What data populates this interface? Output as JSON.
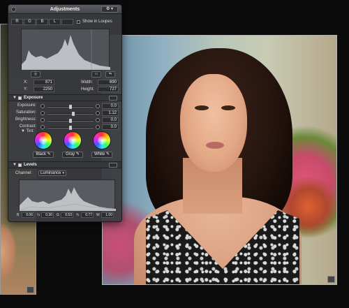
{
  "hud": {
    "title": "Adjustments",
    "gear_label": "⚙ ▾",
    "channels": [
      "R",
      "G",
      "B",
      "L",
      ""
    ],
    "show_in_loupes": "Show in Loupes",
    "tool_buttons": [
      "◎",
      "▭",
      "⇆"
    ],
    "coords": {
      "x_label": "X:",
      "x_value": "871",
      "y_label": "Y:",
      "y_value": "2250",
      "width_label": "Width:",
      "width_value": "690",
      "height_label": "Height:",
      "height_value": "727"
    },
    "exposure": {
      "title": "Exposure",
      "rows": [
        {
          "label": "Exposure:",
          "value": "0.0",
          "pos": 0.5
        },
        {
          "label": "Saturation:",
          "value": "1.12",
          "pos": 0.56
        },
        {
          "label": "Brightness:",
          "value": "0.0",
          "pos": 0.5
        },
        {
          "label": "Contrast:",
          "value": "0.0",
          "pos": 0.5
        }
      ]
    },
    "tint": {
      "label": "Tint:",
      "buttons": [
        "Black",
        "Gray",
        "White"
      ]
    },
    "levels": {
      "title": "Levels",
      "channel_label": "Channel:",
      "channel_value": "Luminance",
      "values": [
        {
          "label": "B",
          "value": "0.06"
        },
        {
          "label": "¼",
          "value": "0.30"
        },
        {
          "label": "G",
          "value": "0.53"
        },
        {
          "label": "¾",
          "value": "0.77"
        },
        {
          "label": "W",
          "value": "1.00"
        }
      ]
    }
  },
  "icons": {
    "close": "close-icon",
    "gear": "gear-icon",
    "wheel": "color-wheel-icon",
    "eyedropper": "eyedropper-icon"
  }
}
